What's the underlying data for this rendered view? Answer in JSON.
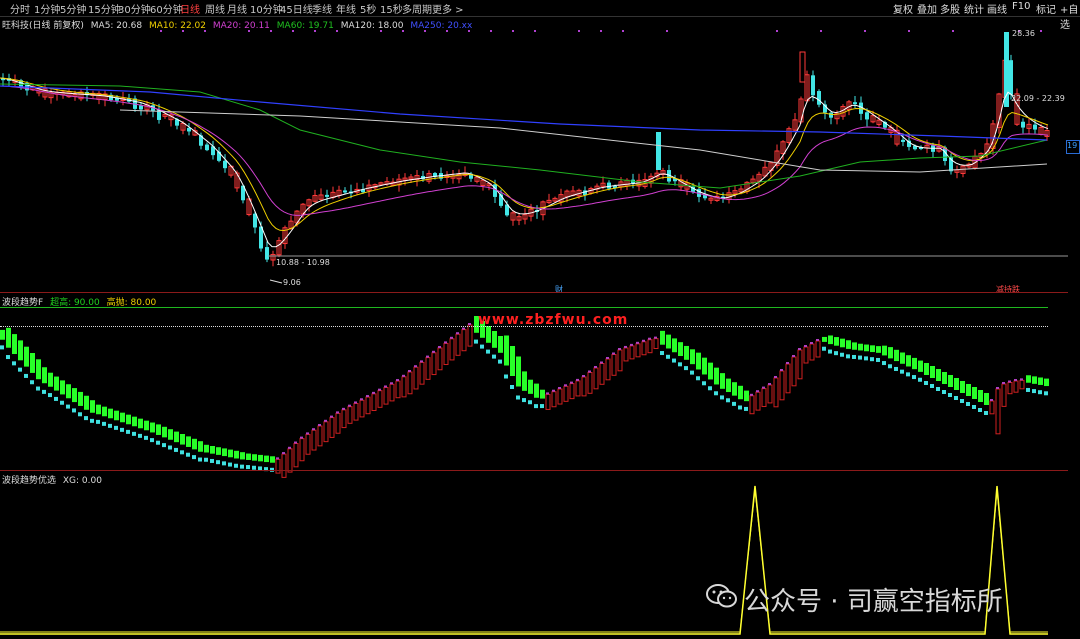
{
  "toolbar": {
    "periods": [
      "分时",
      "1分钟",
      "5分钟",
      "15分钟",
      "30分钟",
      "60分钟",
      "日线",
      "周线",
      "月线",
      "10分钟",
      "45日线",
      "季线",
      "年线",
      "5秒",
      "15秒",
      "多周期",
      "更多 >"
    ],
    "active_period": "日线",
    "right_buttons": [
      "复权",
      "叠加",
      "多股",
      "统计",
      "画线",
      "F10",
      "标记",
      "+自选"
    ]
  },
  "main_legend": {
    "title": "旺科技(日线 前复权)",
    "ma5": "MA5: 20.68",
    "ma10": "MA10: 22.02",
    "ma20": "MA20: 20.11",
    "ma60": "MA60: 19.71",
    "ma120": "MA120: 18.00",
    "ma250": "MA250: 20.xx"
  },
  "price_labels": {
    "high": "28.36",
    "range_top": "22.09 - 22.39",
    "range_low": "10.88 - 10.98",
    "low": "9.06",
    "axis_tag": "19"
  },
  "markers": {
    "cai": "财",
    "red": "减持跌"
  },
  "indicator1": {
    "name": "波段趋势F",
    "label1": "超高: 90.00",
    "label2": "高抛: 80.00"
  },
  "watermark": "www.zbzfwu.com",
  "indicator2": {
    "name": "波段趋势优选",
    "value": "XG: 0.00"
  },
  "brand": "公众号 · 司赢空指标所",
  "colors": {
    "up": "#ff3a3a",
    "down": "#42e6e6",
    "ma5": "#ffffff",
    "ma10": "#f0d000",
    "ma20": "#d040d0",
    "ma60": "#20b020",
    "ma120": "#3040ff",
    "ma250": "#6060ff",
    "green_bar": "#28ff28",
    "cyan_bar": "#40e0e0",
    "red_bar": "#d02020",
    "purple_bar": "#b040c0",
    "xg_line": "#ffff30"
  },
  "chart_data": {
    "type": "candlestick",
    "price_range": [
      9.06,
      28.36
    ],
    "indicator1_levels": [
      90,
      80
    ],
    "xg_spikes": 2
  }
}
